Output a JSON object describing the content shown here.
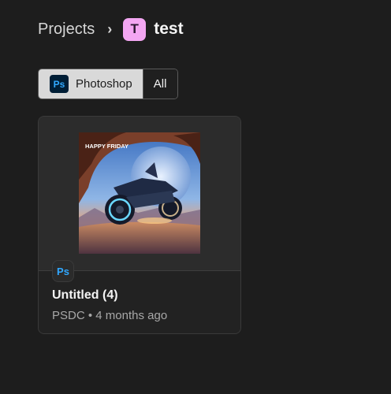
{
  "breadcrumb": {
    "parent": "Projects",
    "separator": "›",
    "project_initial": "T",
    "project_name": "test",
    "avatar_color": "#f3a6f2"
  },
  "filters": [
    {
      "label": "Photoshop",
      "icon": "photoshop-icon",
      "badge": "Ps",
      "selected": true
    },
    {
      "label": "All",
      "selected": false
    }
  ],
  "files": [
    {
      "title": "Untitled (4)",
      "app_badge": "Ps",
      "app_icon": "photoshop-icon",
      "meta": "PSDC • 4 months ago",
      "thumbnail_text": "HAPPY FRIDAY"
    }
  ],
  "colors": {
    "background": "#1d1d1d",
    "ps_badge_bg": "#001e36",
    "ps_badge_fg": "#31a8ff"
  }
}
